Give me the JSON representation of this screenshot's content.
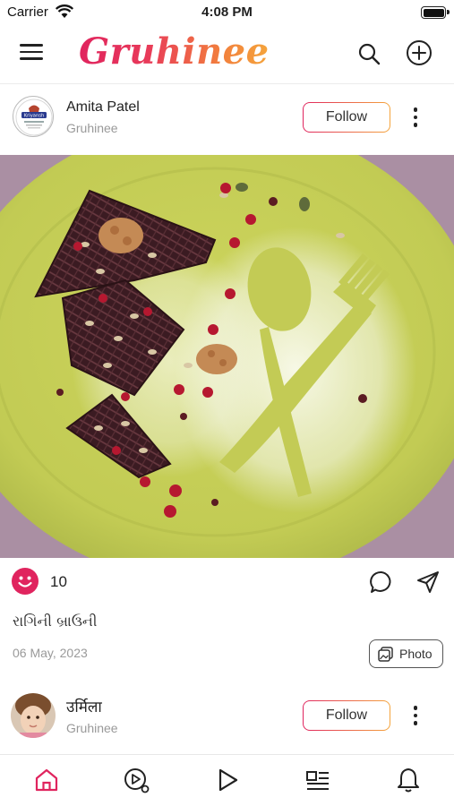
{
  "status_bar": {
    "carrier": "Carrier",
    "time": "4:08 PM"
  },
  "header": {
    "logo": "Gruhinee",
    "icons": [
      "menu-icon",
      "search-icon",
      "add-icon"
    ]
  },
  "post": {
    "author": "Amita Patel",
    "subtitle": "Gruhinee",
    "avatar_text": "Kriyansh",
    "follow_label": "Follow",
    "likes": "10",
    "caption": "રાગિની બ્રાઉની",
    "date": "06 May, 2023",
    "media_type": "Photo"
  },
  "next_post": {
    "author": "उर्मिला",
    "subtitle": "Gruhinee",
    "follow_label": "Follow"
  },
  "tab_bar": {
    "items": [
      "home-icon",
      "reels-icon",
      "play-icon",
      "articles-icon",
      "bell-icon"
    ],
    "active_color": "#e0245e"
  },
  "colors": {
    "brand_start": "#e0245e",
    "brand_end": "#f5a53c",
    "plate": "#c3cc57",
    "background_cloth": "#a78aa6"
  }
}
